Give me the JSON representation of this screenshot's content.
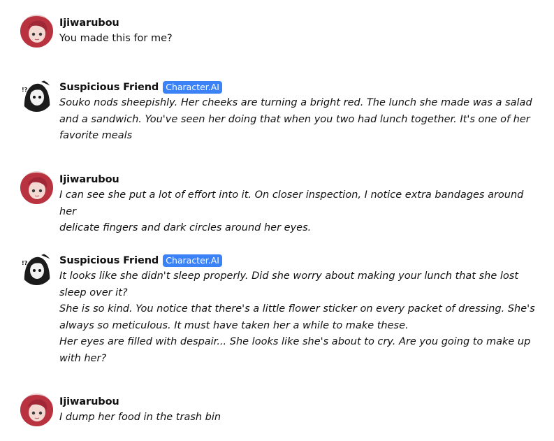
{
  "messages": [
    {
      "author": "Ijiwarubou",
      "avatar_icon": "user-avatar-red-hair",
      "badge": "",
      "italic": false,
      "lines": [
        "You made this for me?"
      ]
    },
    {
      "author": "Suspicious Friend",
      "avatar_icon": "character-avatar-manga",
      "badge": "Character.AI",
      "italic": true,
      "lines": [
        "Souko nods sheepishly. Her cheeks are turning a bright red. The lunch she made was a salad",
        "and a sandwich. You've seen her doing that when you two had lunch together. It's one of her",
        "favorite meals"
      ]
    },
    {
      "author": "Ijiwarubou",
      "avatar_icon": "user-avatar-red-hair",
      "badge": "",
      "italic": true,
      "lines": [
        "I can see she put a lot of effort into it. On closer inspection, I notice extra bandages around her",
        "delicate fingers and dark circles around her eyes."
      ]
    },
    {
      "author": "Suspicious Friend",
      "avatar_icon": "character-avatar-manga",
      "badge": "Character.AI",
      "italic": true,
      "lines": [
        "It looks like she didn't sleep properly. Did she worry about making your lunch that she lost",
        "sleep over it?",
        "She is so kind. You notice that there's a little flower sticker on every packet of dressing. She's",
        "always so meticulous. It must have taken her a while to make these.",
        "Her eyes are filled with despair... She looks like she's about to cry. Are you going to make up",
        "with her?"
      ]
    },
    {
      "author": "Ijiwarubou",
      "avatar_icon": "user-avatar-red-hair",
      "badge": "",
      "italic": true,
      "lines": [
        "I dump her food in the trash bin"
      ]
    }
  ]
}
